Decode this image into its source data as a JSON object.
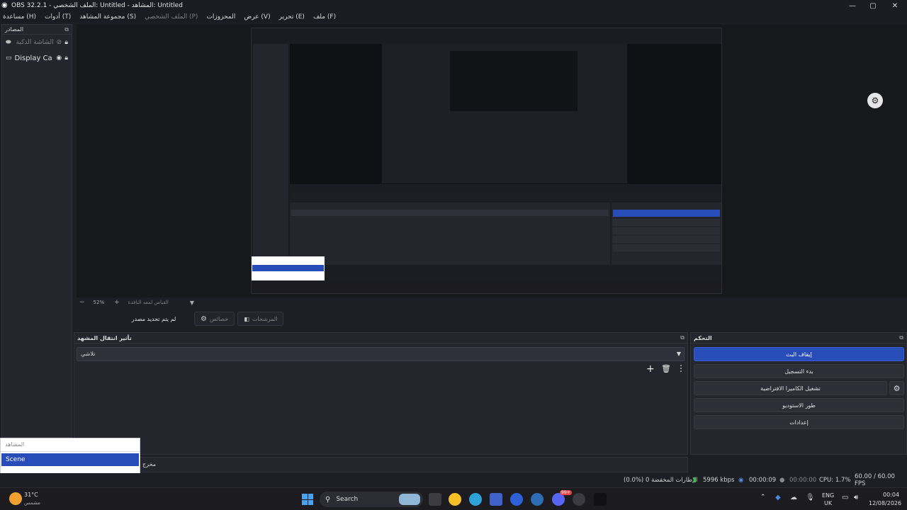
{
  "window": {
    "title": "OBS 32.2.1 - الملف الشخصي: Untitled - المشاهد: Untitled",
    "minimize": "—",
    "maximize": "▢",
    "close": "✕"
  },
  "menu": [
    {
      "label": "ملف (F)",
      "dim": false
    },
    {
      "label": "تحرير (E)",
      "dim": false
    },
    {
      "label": "عرض (V)",
      "dim": false
    },
    {
      "label": "المحزوزات",
      "dim": false
    },
    {
      "label": "الملف الشخصي (P)",
      "dim": true
    },
    {
      "label": "مجموعة المشاهد (S)",
      "dim": false
    },
    {
      "label": "أدوات (T)",
      "dim": false
    },
    {
      "label": "مساعدة (H)",
      "dim": false
    }
  ],
  "sources": {
    "title": "المصادر",
    "items": [
      {
        "label": "الشاشة الذكية",
        "dim": true
      },
      {
        "label": "Display Ca",
        "dim": false
      }
    ]
  },
  "zoom": {
    "value": "52%",
    "minus": "−",
    "plus": "+",
    "mode": "القياس لمعه النافذة"
  },
  "toolbar": {
    "no_source": "لم يتم تحديد مصدر",
    "properties": "خصائص",
    "filters": "المرشحات"
  },
  "transitions": {
    "title": "تأثير انتقال المشهد",
    "selected": "تلاشي"
  },
  "controls": {
    "title": "التحكم",
    "buttons": [
      "إيقاف البث",
      "بدء التسجيل",
      "تشغيل الكاميرا الافتراضية",
      "طور الاستوديو",
      "إعدادات"
    ]
  },
  "scenes": {
    "title": "المشاهد",
    "selected": "Scene",
    "exit_label": "مخرج"
  },
  "status": {
    "dropped_frames": "الإطارات المخفضة 0 (%0.0)",
    "bitrate": "5996 kbps",
    "stream_time": "00:00:09",
    "rec_time": "00:00:00",
    "cpu": "CPU: 1.7%",
    "fps": "60.00 / 60.00 FPS"
  },
  "taskbar": {
    "weather_temp": "31°C",
    "weather_desc": "مشمس",
    "search_placeholder": "Search",
    "lang_top": "ENG",
    "lang_bottom": "UK",
    "time": "00:04",
    "date": "12/08/2026",
    "badge_count": "99+"
  },
  "colors": {
    "accent": "#284cb8",
    "panel": "#25262d",
    "bg": "#1e1f25"
  }
}
